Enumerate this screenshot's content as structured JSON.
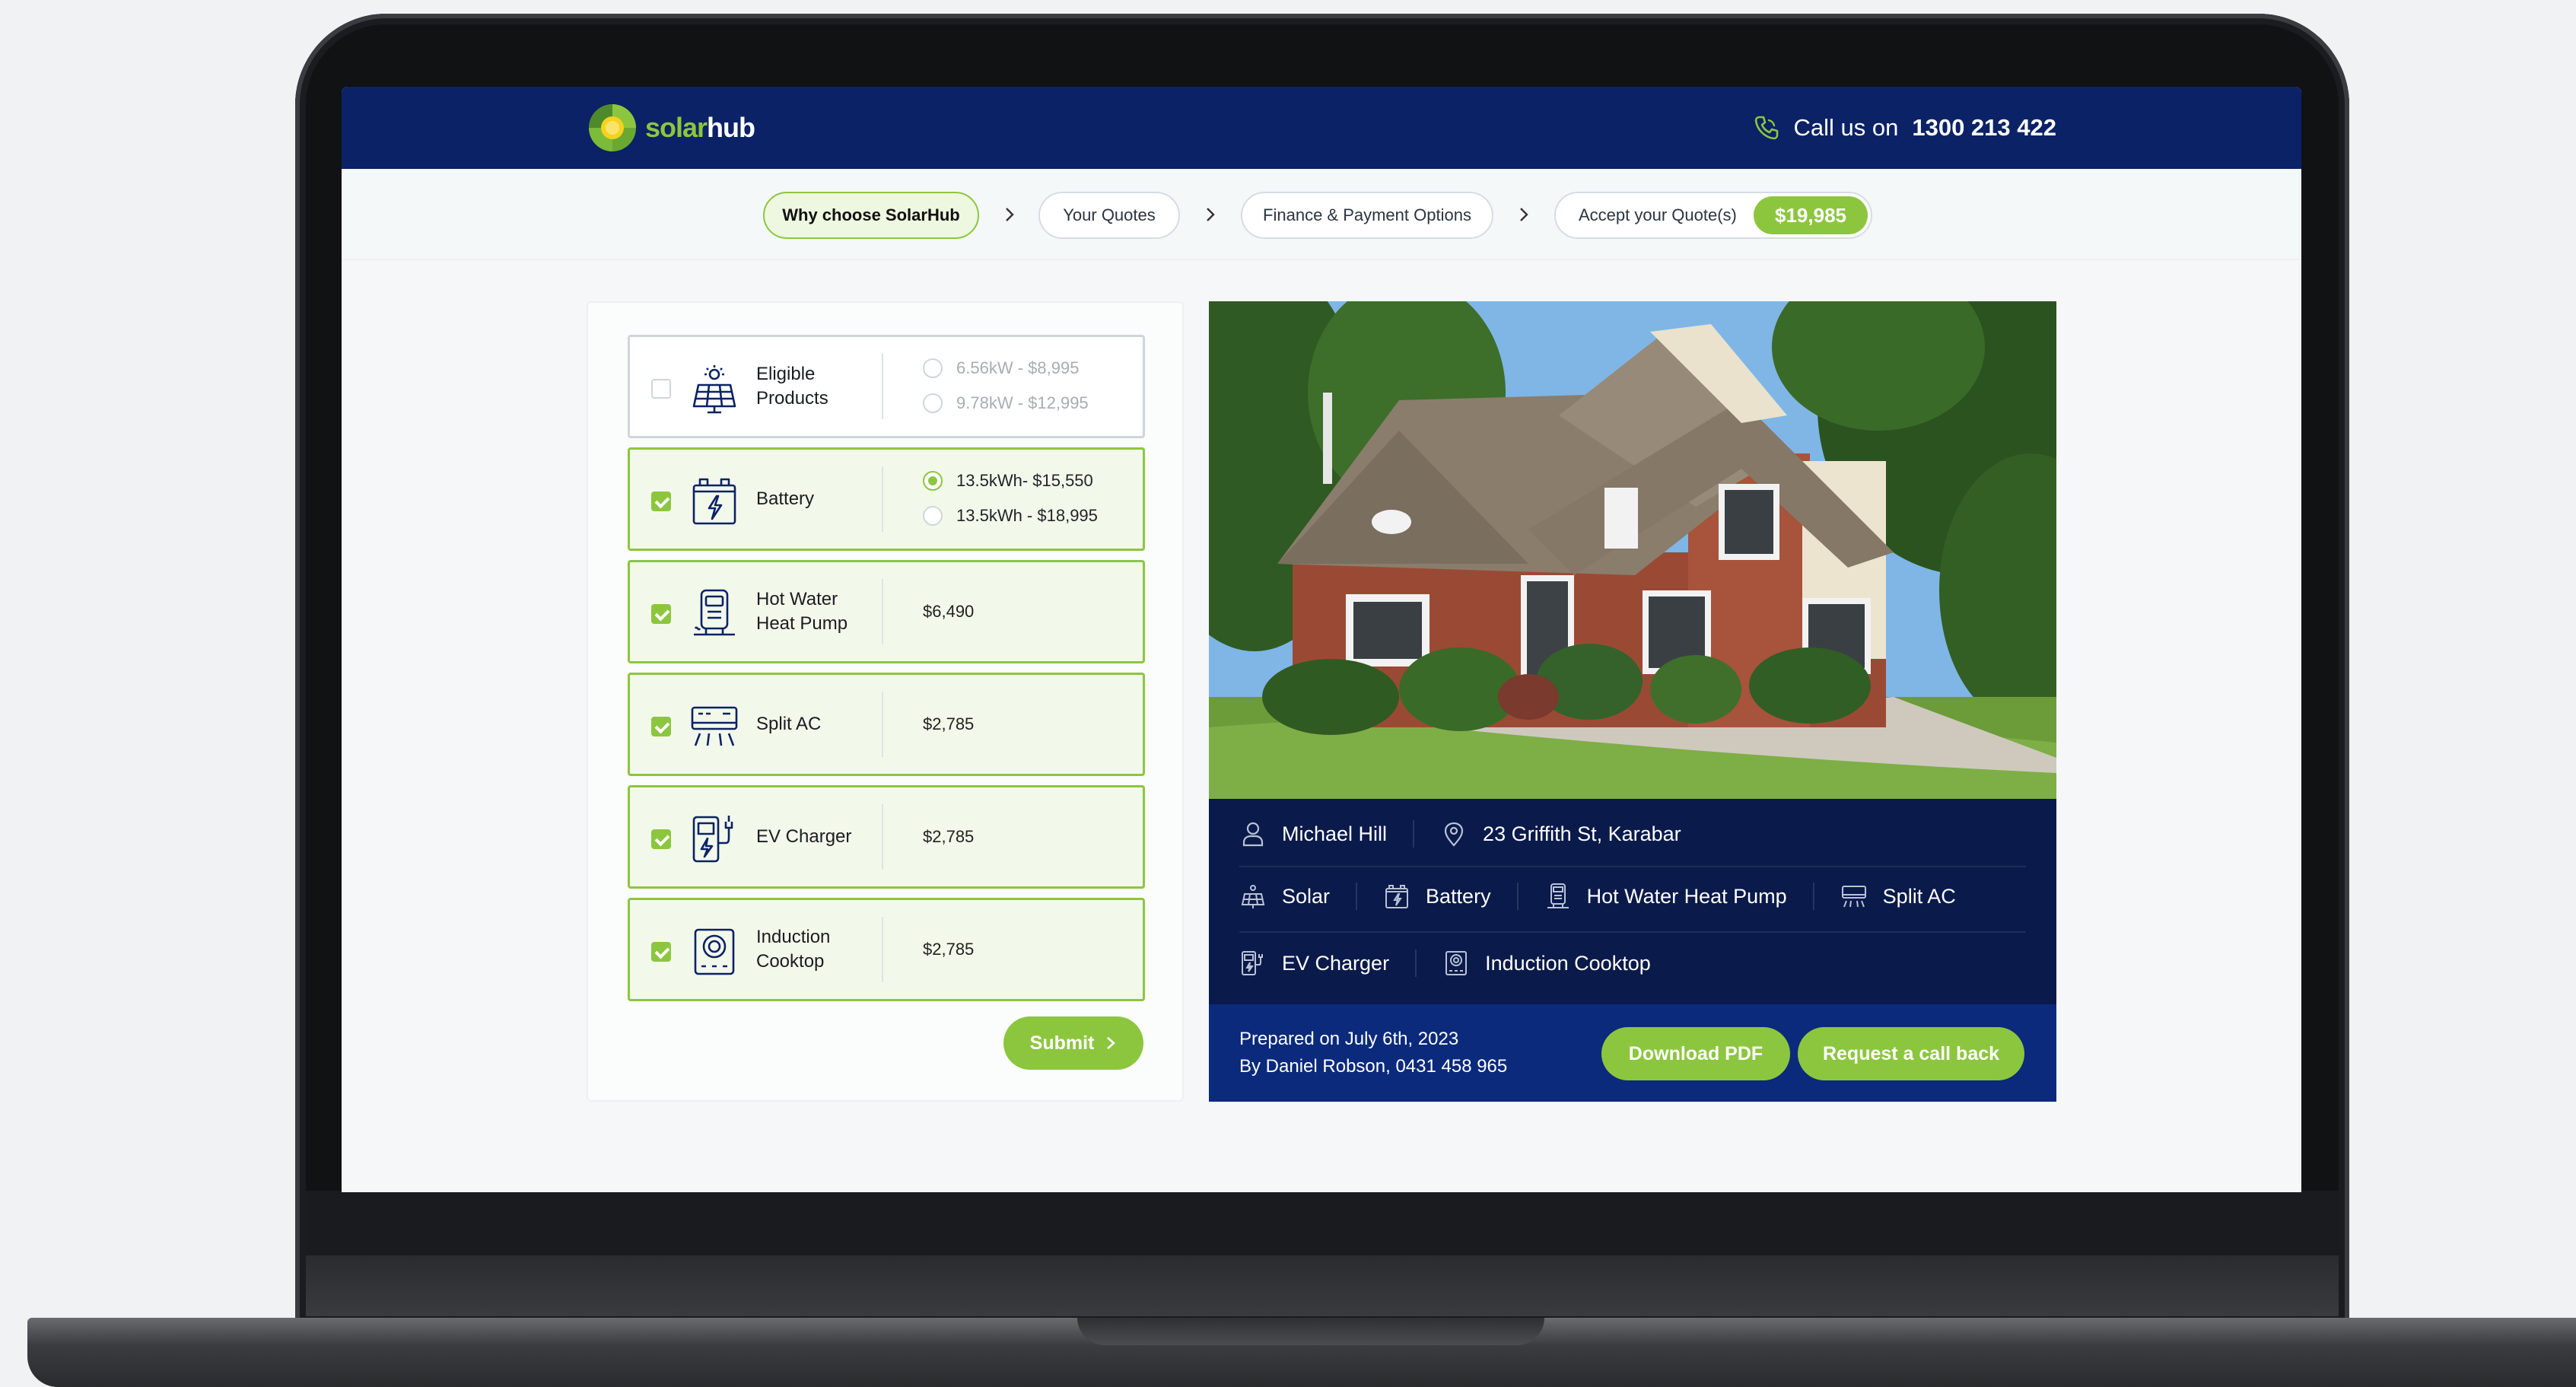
{
  "header": {
    "logo_part1": "solar",
    "logo_part2": "hub",
    "call_prefix": "Call us on",
    "call_number": "1300 213 422"
  },
  "steps": [
    {
      "label": "Why choose SolarHub",
      "active": true
    },
    {
      "label": "Your Quotes",
      "active": false
    },
    {
      "label": "Finance & Payment Options",
      "active": false
    },
    {
      "label": "Accept your Quote(s)",
      "active": false
    }
  ],
  "total_price": "$19,985",
  "products": [
    {
      "name": "Eligible\nProducts",
      "icon": "solar-panel-icon",
      "checked": false,
      "options": [
        {
          "label": "6.56kW - $8,995",
          "selected": false
        },
        {
          "label": "9.78kW - $12,995",
          "selected": false
        }
      ]
    },
    {
      "name": "Battery",
      "icon": "battery-icon",
      "checked": true,
      "options": [
        {
          "label": "13.5kWh- $15,550",
          "selected": true
        },
        {
          "label": "13.5kWh - $18,995",
          "selected": false
        }
      ]
    },
    {
      "name": "Hot Water\nHeat Pump",
      "icon": "heat-pump-icon",
      "checked": true,
      "price": "$6,490"
    },
    {
      "name": "Split AC",
      "icon": "split-ac-icon",
      "checked": true,
      "price": "$2,785"
    },
    {
      "name": "EV Charger",
      "icon": "ev-charger-icon",
      "checked": true,
      "price": "$2,785"
    },
    {
      "name": "Induction\nCooktop",
      "icon": "induction-cooktop-icon",
      "checked": true,
      "price": "$2,785"
    }
  ],
  "submit_label": "Submit",
  "customer": {
    "name": "Michael Hill",
    "address": "23 Griffith St, Karabar"
  },
  "summary_items_row1": [
    "Solar",
    "Battery",
    "Hot Water Heat Pump",
    "Split AC"
  ],
  "summary_items_row2": [
    "EV Charger",
    "Induction Cooktop"
  ],
  "prepared_on": "Prepared on July 6th, 2023",
  "prepared_by": "By Daniel Robson, 0431 458 965",
  "download_label": "Download PDF",
  "callback_label": "Request a call back",
  "colors": {
    "brand_navy": "#0b2266",
    "brand_green": "#8cc63f"
  }
}
